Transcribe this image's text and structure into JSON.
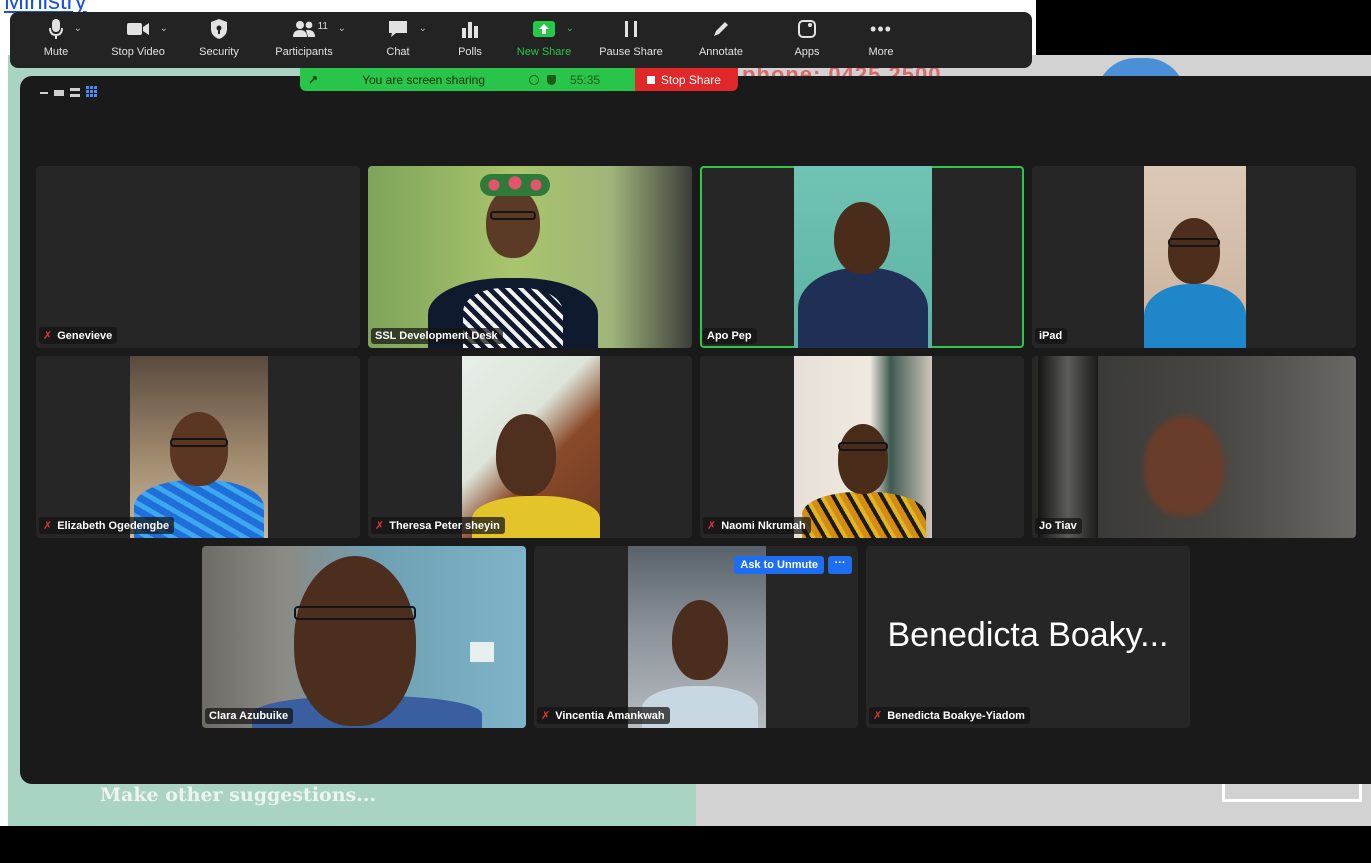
{
  "top_link": "Ministry",
  "slide": {
    "number_text": "phone: 0425 2500",
    "bottom_text": "Make other suggestions..."
  },
  "toolbar": {
    "items": [
      {
        "label": "Mute",
        "icon": "microphone-icon",
        "has_caret": true
      },
      {
        "label": "Stop Video",
        "icon": "video-camera-icon",
        "has_caret": true
      },
      {
        "label": "Security",
        "icon": "shield-icon",
        "has_caret": false
      },
      {
        "label": "Participants",
        "icon": "people-icon",
        "badge": "11",
        "has_caret": true
      },
      {
        "label": "Chat",
        "icon": "chat-bubble-icon",
        "has_caret": true
      },
      {
        "label": "Polls",
        "icon": "bar-chart-icon",
        "has_caret": false
      },
      {
        "label": "New Share",
        "icon": "share-screen-icon",
        "has_caret": true,
        "color": "#25c848"
      },
      {
        "label": "Pause Share",
        "icon": "pause-icon",
        "has_caret": false
      },
      {
        "label": "Annotate",
        "icon": "pencil-icon",
        "has_caret": false
      },
      {
        "label": "Apps",
        "icon": "apps-icon",
        "has_caret": false
      },
      {
        "label": "More",
        "icon": "ellipsis-icon",
        "has_caret": false
      }
    ]
  },
  "share_banner": {
    "message": "You are screen sharing",
    "timer": "55:35",
    "stop_label": "Stop Share",
    "green": "#29c44a",
    "red": "#e02828"
  },
  "participants": [
    {
      "name": "Genevieve",
      "muted": true,
      "video": false
    },
    {
      "name": "SSL Development Desk",
      "muted": false,
      "video": true
    },
    {
      "name": "Apo Pep",
      "muted": false,
      "video": true,
      "active_speaker": true
    },
    {
      "name": "iPad",
      "muted": false,
      "video": true
    },
    {
      "name": "Elizabeth Ogedengbe",
      "muted": true,
      "video": true
    },
    {
      "name": "Theresa Peter sheyin",
      "muted": true,
      "video": true
    },
    {
      "name": "Naomi Nkrumah",
      "muted": true,
      "video": true
    },
    {
      "name": "Jo Tiav",
      "muted": false,
      "video": true
    },
    {
      "name": "Clara Azubuike",
      "muted": false,
      "video": true
    },
    {
      "name": "Vincentia Amankwah",
      "muted": true,
      "video": true,
      "ask_to_unmute": "Ask to Unmute",
      "more": "···"
    },
    {
      "name": "Benedicta Boakye-Yiadom",
      "display_name": "Benedicta Boaky...",
      "muted": true,
      "video": false
    }
  ],
  "mute_glyph": "✗"
}
